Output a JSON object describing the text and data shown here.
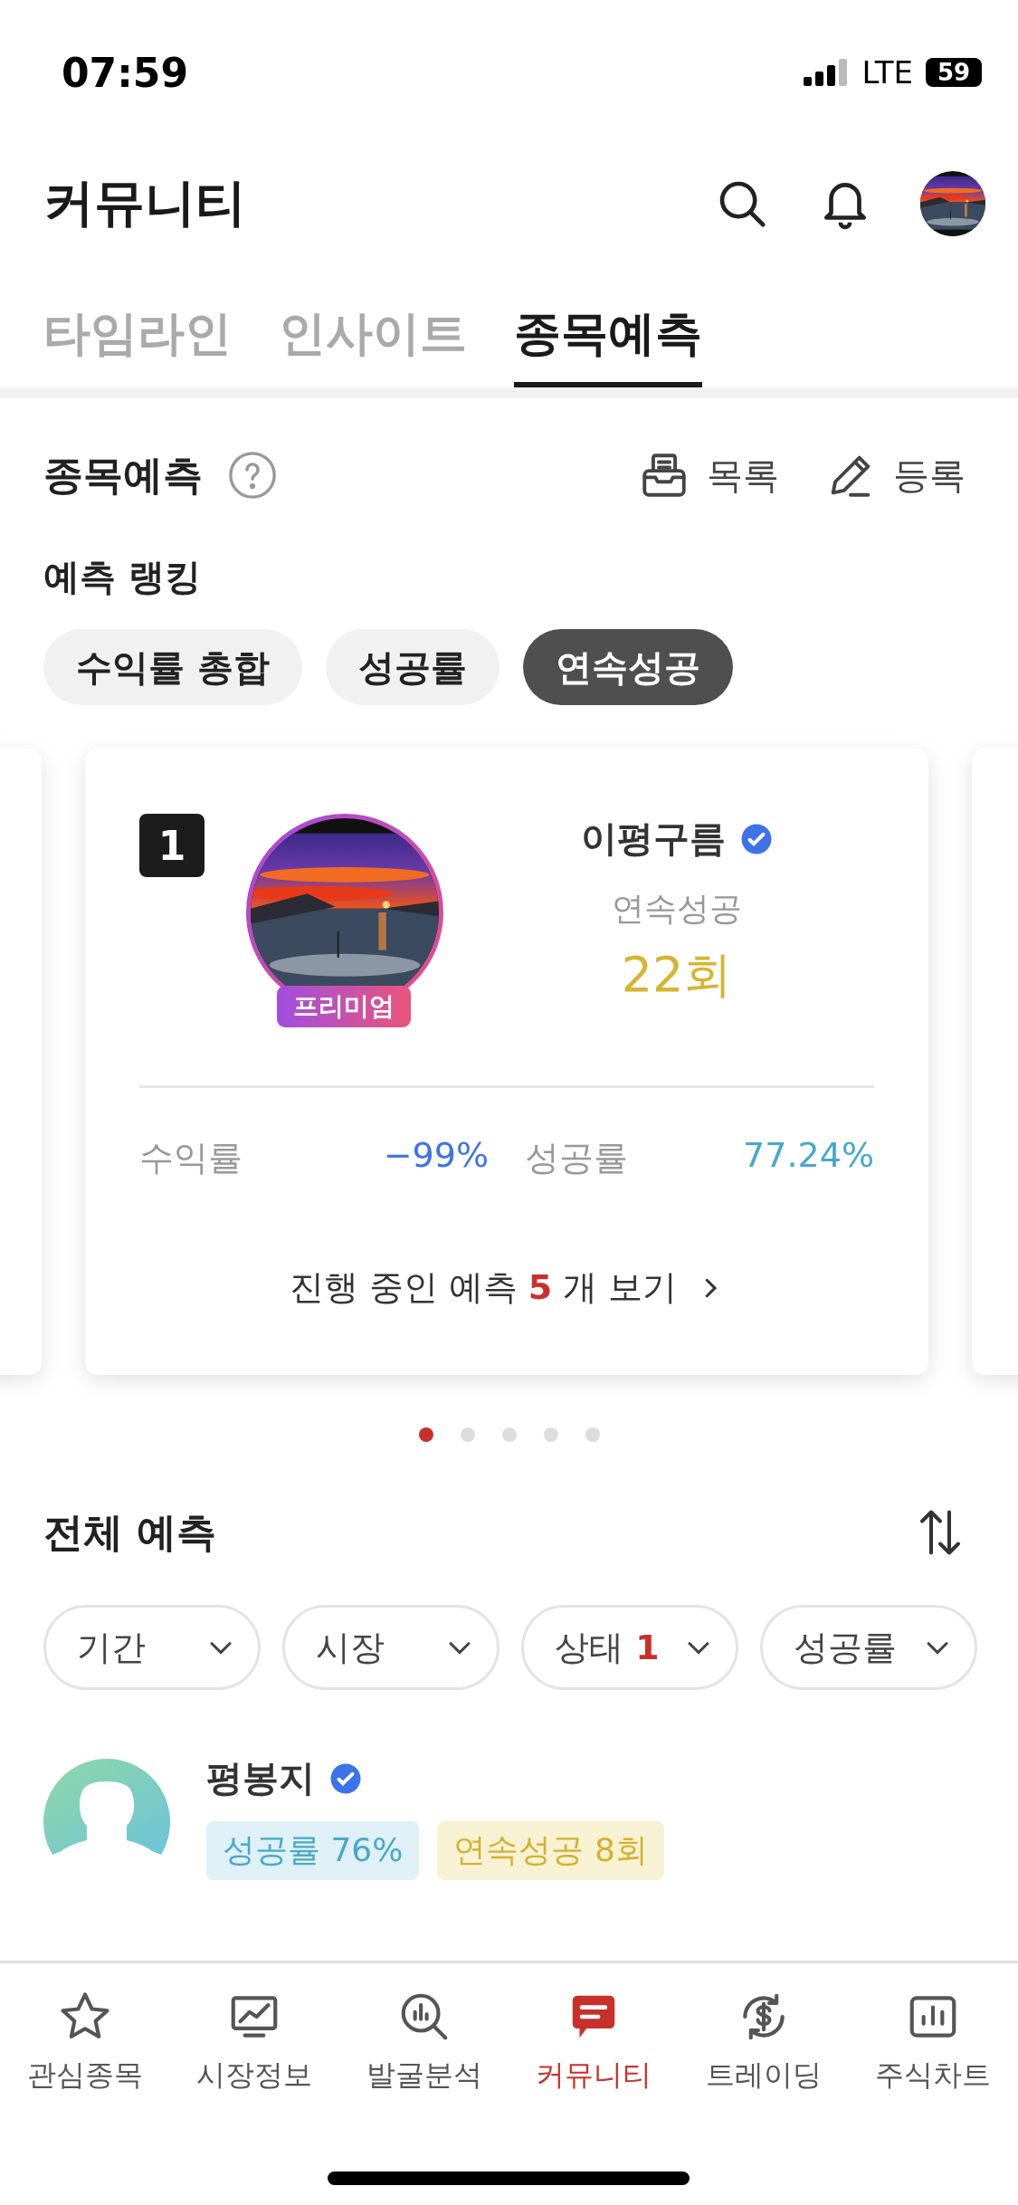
{
  "status_bar": {
    "time": "07:59",
    "network": "LTE",
    "battery": "59"
  },
  "header": {
    "title": "커뮤니티"
  },
  "tabs": [
    {
      "label": "타임라인",
      "selected": false
    },
    {
      "label": "인사이트",
      "selected": false
    },
    {
      "label": "종목예측",
      "selected": true
    }
  ],
  "section": {
    "title": "종목예측",
    "actions": [
      {
        "label": "목록",
        "kind": "list"
      },
      {
        "label": "등록",
        "kind": "write"
      }
    ]
  },
  "ranking": {
    "title": "예측 랭킹",
    "chips": [
      {
        "label": "수익률 총합",
        "selected": false
      },
      {
        "label": "성공률",
        "selected": false
      },
      {
        "label": "연속성공",
        "selected": true
      }
    ],
    "card": {
      "rank": "1",
      "badge": "프리미엄",
      "name": "이평구름",
      "verified": true,
      "metric_label": "연속성공",
      "metric_value": "22회",
      "stats": [
        {
          "label": "수익률",
          "value": "−99%",
          "kind": "return"
        },
        {
          "label": "성공률",
          "value": "77.24%",
          "kind": "rate"
        }
      ],
      "link": {
        "prefix": "진행 중인 예측",
        "count": "5",
        "suffix": "개 보기"
      }
    },
    "pages": [
      {
        "selected": true
      },
      {
        "selected": false
      },
      {
        "selected": false
      },
      {
        "selected": false
      },
      {
        "selected": false
      }
    ]
  },
  "all_predictions": {
    "title": "전체 예측",
    "filters": [
      {
        "label": "기간"
      },
      {
        "label": "시장"
      },
      {
        "label": "상태",
        "count": "1"
      },
      {
        "label": "성공률"
      }
    ],
    "users": [
      {
        "name": "평봉지",
        "verified": true,
        "tags": [
          {
            "label": "성공률 76%",
            "kind": "rate"
          },
          {
            "label": "연속성공 8회",
            "kind": "streak"
          }
        ]
      }
    ]
  },
  "bottom_nav": [
    {
      "label": "관심종목",
      "kind": "star",
      "selected": false
    },
    {
      "label": "시장정보",
      "kind": "market",
      "selected": false
    },
    {
      "label": "발굴분석",
      "kind": "analysis",
      "selected": false
    },
    {
      "label": "커뮤니티",
      "kind": "community",
      "selected": true
    },
    {
      "label": "트레이딩",
      "kind": "trading",
      "selected": false
    },
    {
      "label": "주식차트",
      "kind": "chart",
      "selected": false
    }
  ]
}
